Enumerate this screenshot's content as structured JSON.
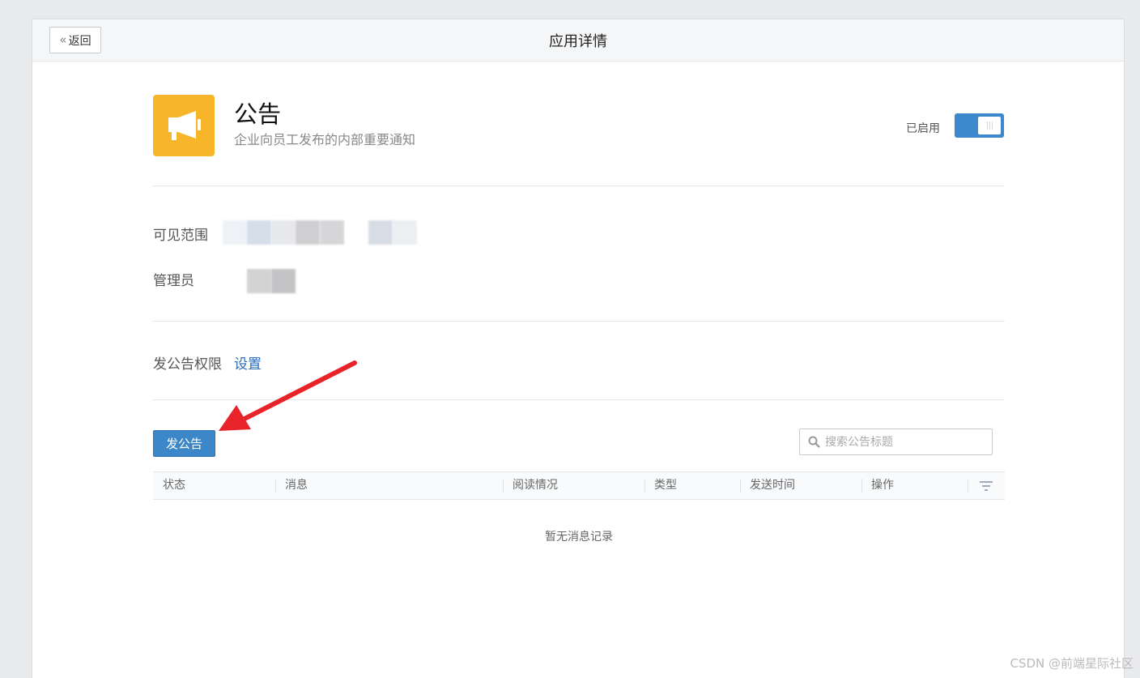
{
  "header": {
    "back_label": "返回",
    "title": "应用详情"
  },
  "app": {
    "name": "公告",
    "description": "企业向员工发布的内部重要通知",
    "icon": "megaphone-icon",
    "icon_color": "#f7b52a",
    "enabled_label": "已启用",
    "enabled": true,
    "toggle_color": "#3b88cc"
  },
  "info": {
    "visibility_label": "可见范围",
    "admin_label": "管理员"
  },
  "permission": {
    "label": "发公告权限",
    "link_label": "设置"
  },
  "toolbar": {
    "post_button_label": "发公告",
    "search_placeholder": "搜索公告标题",
    "search_value": ""
  },
  "table": {
    "columns": [
      "状态",
      "消息",
      "阅读情况",
      "类型",
      "发送时间",
      "操作"
    ],
    "empty_text": "暂无消息记录"
  },
  "watermark": "CSDN @前端星际社区"
}
